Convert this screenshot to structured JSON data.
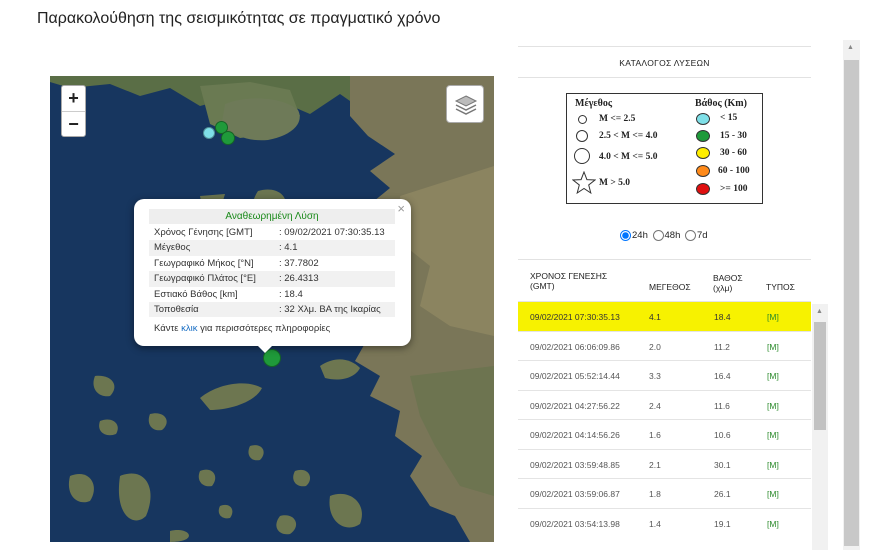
{
  "page": {
    "title": "Παρακολούθηση της σεισμικότητας σε πραγματικό χρόνο"
  },
  "map": {
    "zoom_in": "+",
    "zoom_out": "−",
    "popup": {
      "close": "×",
      "header": "Αναθεωρημένη Λύση",
      "rows": [
        {
          "k": "Χρόνος Γένησης [GMT]",
          "v": ": 09/02/2021 07:30:35.13"
        },
        {
          "k": "Μέγεθος",
          "v": ": 4.1"
        },
        {
          "k": "Γεωγραφικό Μήκος [°N]",
          "v": ": 37.7802"
        },
        {
          "k": "Γεωγραφικό Πλάτος [°E]",
          "v": ": 26.4313"
        },
        {
          "k": "Εστιακό Βάθος [km]",
          "v": ": 18.4"
        },
        {
          "k": "Τοποθεσία",
          "v": ": 32 Χλμ. ΒΑ της Ικαρίας"
        }
      ],
      "more_before": "Κάντε ",
      "more_link": "κλικ",
      "more_after": " για περισσότερες πληροφορίες"
    }
  },
  "panel": {
    "title": "ΚΑΤΑΛΟΓΟΣ ΛΥΣΕΩΝ",
    "legend": {
      "magnitude_title": "Μέγεθος",
      "depth_title": "Βάθος (Km)",
      "magnitudes": [
        "M <= 2.5",
        "2.5 < M <= 4.0",
        "4.0 < M <= 5.0",
        "M > 5.0"
      ],
      "depths": [
        {
          "label": "< 15",
          "color": "#7fe0e8"
        },
        {
          "label": "15 - 30",
          "color": "#1f9a3a"
        },
        {
          "label": "30 - 60",
          "color": "#ffee00"
        },
        {
          "label": "60 - 100",
          "color": "#ff8a1a"
        },
        {
          "label": ">= 100",
          "color": "#e01010"
        }
      ]
    },
    "timespan": {
      "selected": "24h",
      "options": [
        "24h",
        "48h",
        "7d"
      ]
    },
    "table": {
      "headers": [
        "ΧΡΟΝΟΣ ΓΕΝΕΣΗΣ (GMT)",
        "ΜΕΓΕΘΟΣ",
        "ΒΑΘΟΣ (χλμ)",
        "ΤΥΠΟΣ"
      ],
      "rows": [
        {
          "time": "09/02/2021 07:30:35.13",
          "mag": "4.1",
          "depth": "18.4",
          "type": "[M]",
          "selected": true
        },
        {
          "time": "09/02/2021 06:06:09.86",
          "mag": "2.0",
          "depth": "11.2",
          "type": "[M]"
        },
        {
          "time": "09/02/2021 05:52:14.44",
          "mag": "3.3",
          "depth": "16.4",
          "type": "[M]"
        },
        {
          "time": "09/02/2021 04:27:56.22",
          "mag": "2.4",
          "depth": "11.6",
          "type": "[M]"
        },
        {
          "time": "09/02/2021 04:14:56.26",
          "mag": "1.6",
          "depth": "10.6",
          "type": "[M]"
        },
        {
          "time": "09/02/2021 03:59:48.85",
          "mag": "2.1",
          "depth": "30.1",
          "type": "[M]"
        },
        {
          "time": "09/02/2021 03:59:06.87",
          "mag": "1.8",
          "depth": "26.1",
          "type": "[M]"
        },
        {
          "time": "09/02/2021 03:54:13.98",
          "mag": "1.4",
          "depth": "19.1",
          "type": "[M]"
        }
      ]
    }
  },
  "icons": {
    "layers": "layers-icon",
    "star": "star-icon",
    "scroll_up": "▲"
  }
}
